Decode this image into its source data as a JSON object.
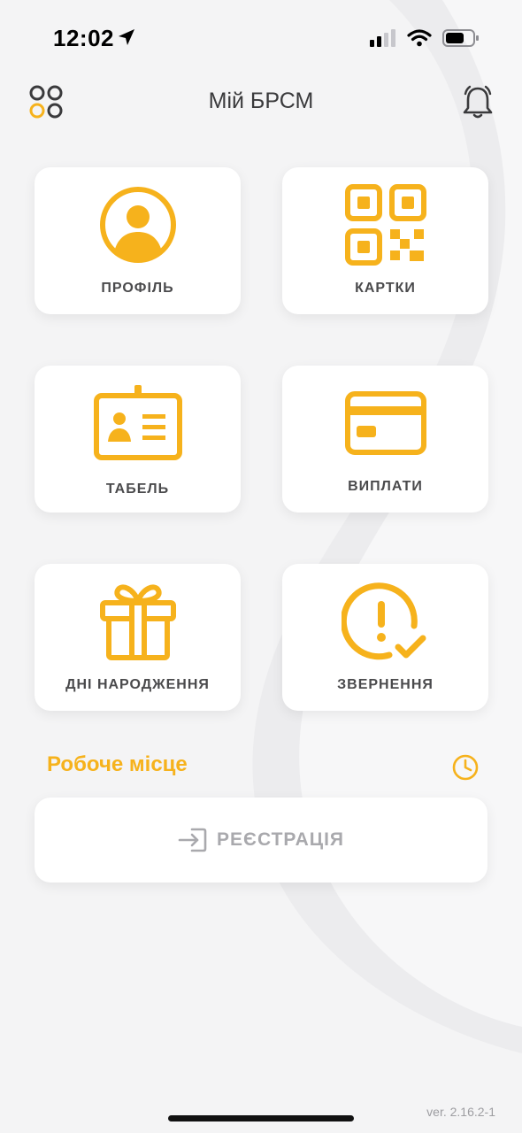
{
  "status_bar": {
    "time": "12:02"
  },
  "header": {
    "title": "Мій БРСМ"
  },
  "tiles": [
    {
      "label": "ПРОФІЛЬ",
      "icon": "profile-icon"
    },
    {
      "label": "КАРТКИ",
      "icon": "qr-code-icon"
    },
    {
      "label": "ТАБЕЛЬ",
      "icon": "id-badge-icon"
    },
    {
      "label": "ВИПЛАТИ",
      "icon": "credit-card-icon"
    },
    {
      "label": "ДНІ НАРОДЖЕННЯ",
      "icon": "gift-icon"
    },
    {
      "label": "ЗВЕРНЕННЯ",
      "icon": "alert-check-icon"
    }
  ],
  "workplace": {
    "title": "Робоче місце",
    "register_label": "РЕЄСТРАЦІЯ"
  },
  "footer": {
    "version": "ver. 2.16.2-1"
  },
  "colors": {
    "accent": "#f6b21c",
    "background": "#f4f4f5",
    "card": "#ffffff",
    "muted": "#a9a9ad"
  }
}
